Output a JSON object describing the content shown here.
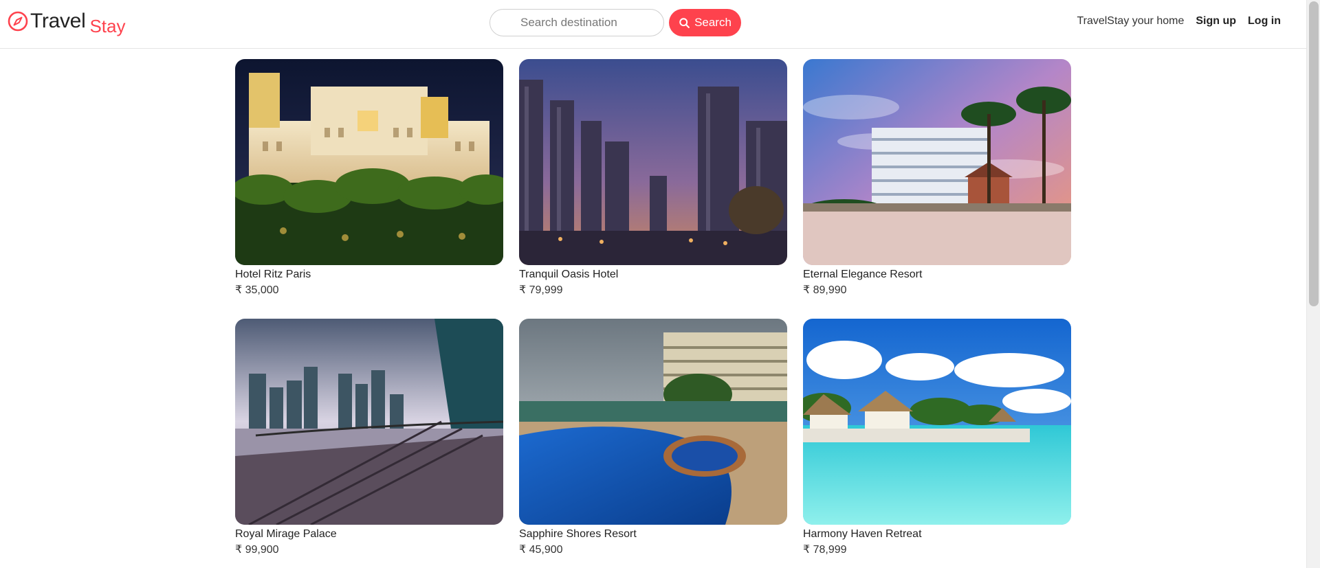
{
  "brand": {
    "name": "Travel",
    "suffix": "Stay",
    "icon": "compass-icon",
    "accent": "#fe424d"
  },
  "search": {
    "placeholder": "Search destination",
    "value": "",
    "button_label": "Search",
    "button_icon": "search-icon"
  },
  "nav": {
    "home_label": "TravelStay your home",
    "signup_label": "Sign up",
    "login_label": "Log in"
  },
  "listings": [
    {
      "title": "Hotel Ritz Paris",
      "price": "₹ 35,000",
      "image": "palace-hotel-night"
    },
    {
      "title": "Tranquil Oasis Hotel",
      "price": "₹ 79,999",
      "image": "marina-skyline-dusk"
    },
    {
      "title": "Eternal Elegance Resort",
      "price": "₹ 89,990",
      "image": "beach-tower-sunset"
    },
    {
      "title": "Royal Mirage Palace",
      "price": "₹ 99,900",
      "image": "city-skyline-waterfront"
    },
    {
      "title": "Sapphire Shores Resort",
      "price": "₹ 45,900",
      "image": "resort-pool"
    },
    {
      "title": "Harmony Haven Retreat",
      "price": "₹ 78,999",
      "image": "tropical-lagoon-huts"
    }
  ]
}
